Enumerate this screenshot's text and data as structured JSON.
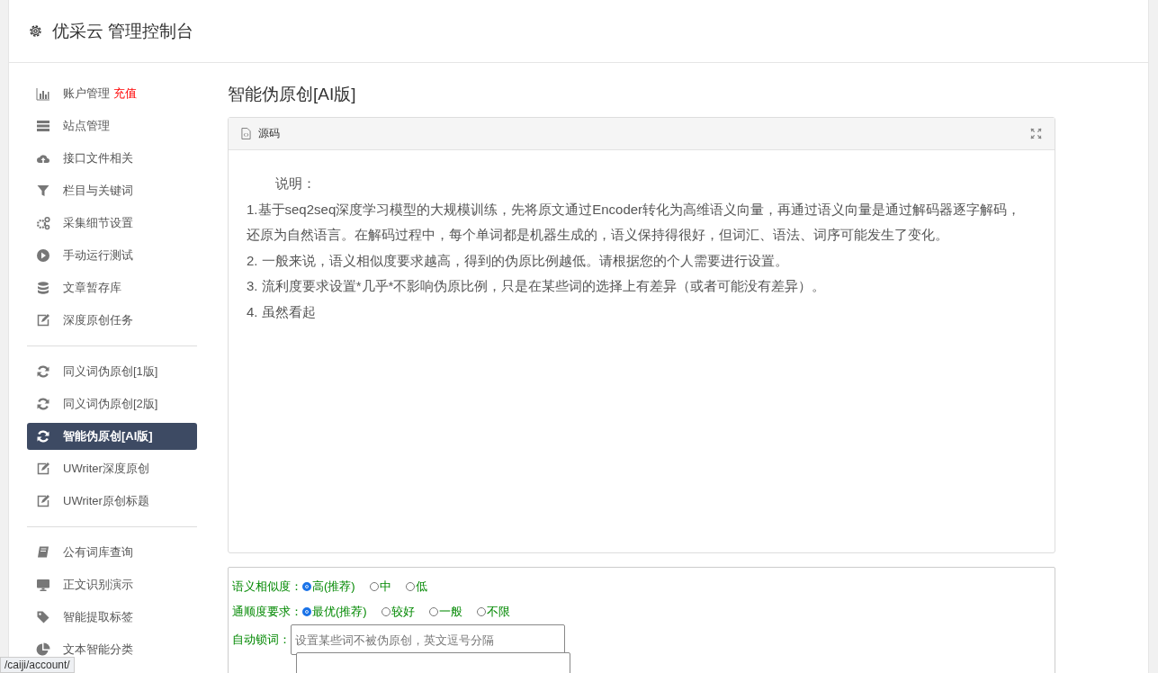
{
  "header": {
    "title": "优采云 管理控制台"
  },
  "sidebar": {
    "groups": [
      {
        "items": [
          {
            "label": "账户管理",
            "badge": "充值",
            "selected": false
          },
          {
            "label": "站点管理",
            "selected": false
          },
          {
            "label": "接口文件相关",
            "selected": false
          },
          {
            "label": "栏目与关键词",
            "selected": false
          },
          {
            "label": "采集细节设置",
            "selected": false
          },
          {
            "label": "手动运行测试",
            "selected": false
          },
          {
            "label": "文章暂存库",
            "selected": false
          },
          {
            "label": "深度原创任务",
            "selected": false
          }
        ]
      },
      {
        "items": [
          {
            "label": "同义词伪原创[1版]",
            "selected": false
          },
          {
            "label": "同义词伪原创[2版]",
            "selected": false
          },
          {
            "label": "智能伪原创[AI版]",
            "selected": true
          },
          {
            "label": "UWriter深度原创",
            "selected": false
          },
          {
            "label": "UWriter原创标题",
            "selected": false
          }
        ]
      },
      {
        "items": [
          {
            "label": "公有词库查询",
            "selected": false
          },
          {
            "label": "正文识别演示",
            "selected": false
          },
          {
            "label": "智能提取标签",
            "selected": false
          },
          {
            "label": "文本智能分类",
            "selected": false
          }
        ]
      }
    ]
  },
  "main": {
    "title": "智能伪原创[AI版]",
    "editor": {
      "tab": "源码",
      "lines": [
        "说明：",
        "1.基于seq2seq深度学习模型的大规模训练，先将原文通过Encoder转化为高维语义向量，再通过语义向量是通过解码器逐字解码，还原为自然语言。在解码过程中，每个单词都是机器生成的，语义保持得很好，但词汇、语法、词序可能发生了变化。",
        "2. 一般来说，语义相似度要求越高，得到的伪原比例越低。请根据您的个人需要进行设置。",
        "3. 流利度要求设置*几乎*不影响伪原比例，只是在某些词的选择上有差异（或者可能没有差异）。",
        "4. 虽然看起"
      ]
    },
    "options": [
      {
        "kind": "radio",
        "label": "语义相似度：",
        "choices": [
          {
            "label": "高(推荐)",
            "selected": true
          },
          {
            "label": "中",
            "selected": false
          },
          {
            "label": "低",
            "selected": false
          }
        ]
      },
      {
        "kind": "radio",
        "label": "通顺度要求：",
        "choices": [
          {
            "label": "最优(推荐)",
            "selected": true
          },
          {
            "label": "较好",
            "selected": false
          },
          {
            "label": "一般",
            "selected": false
          },
          {
            "label": "不限",
            "selected": false
          }
        ]
      },
      {
        "kind": "text",
        "label": "自动锁词：",
        "placeholder": "设置某些词不被伪原创，英文逗号分隔"
      },
      {
        "kind": "blank"
      }
    ]
  },
  "status_bar": {
    "url": "/caiji/account/"
  }
}
